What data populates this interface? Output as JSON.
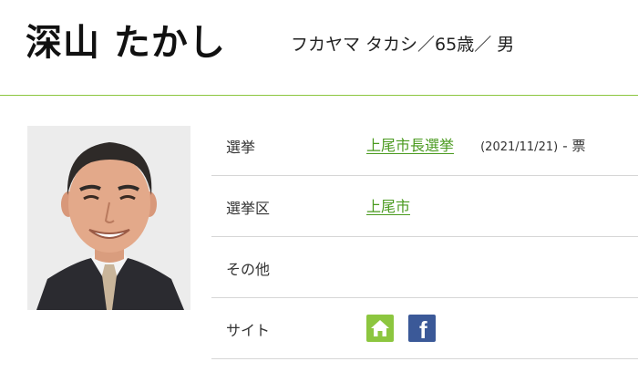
{
  "header": {
    "name": "深山 たかし",
    "subinfo": "フカヤマ タカシ／65歳／ 男"
  },
  "photo": {
    "alt": "深山 たかし"
  },
  "table": {
    "rows": [
      {
        "label": "選挙",
        "value": "上尾市長選挙",
        "date": "(2021/11/21)",
        "votes": " - 票"
      },
      {
        "label": "選挙区",
        "value": "上尾市"
      },
      {
        "label": "その他",
        "value": ""
      },
      {
        "label": "サイト",
        "icons": [
          "home-icon",
          "facebook-icon"
        ],
        "facebook_letter": "f"
      }
    ]
  },
  "colors": {
    "accent_green": "#8cc63f",
    "link_green": "#4a9a1f",
    "facebook_blue": "#3b5998",
    "divider": "#d6d6d6"
  }
}
